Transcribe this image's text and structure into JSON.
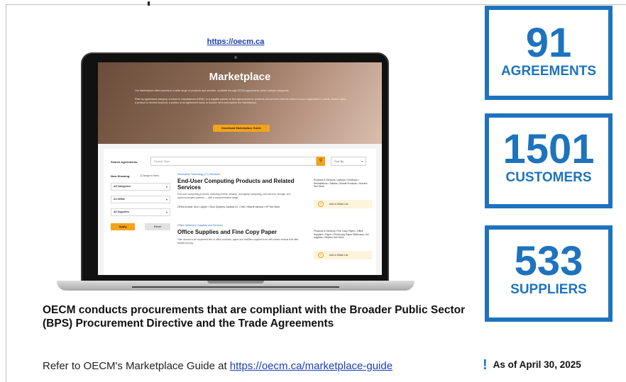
{
  "top_url": "https://oecm.ca",
  "marketplace": {
    "title": "Marketplace",
    "intro": "Our Marketplace offers access to a wide range of products and services, available through OECM agreements within multiple categories.",
    "intro2": "Filter by agreement category, a brand or manufacturer (OEM), or a supplier partner to find agreements for products and services that are based on your organization's needs. Search using a product or service keyword, a portion of an agreement name or another term and explore the Marketplace.",
    "download_label": "Download Marketplace Guide",
    "search_label": "Search Agreements",
    "search_placeholder": "Search Term",
    "search_icon": "magnifier-icon",
    "sort_label": "Sort By",
    "now_showing": "Now Showing:",
    "change_filter": "(Change to filter)",
    "filters": [
      "All Categories",
      "All OEMs",
      "All Suppliers"
    ],
    "apply_label": "Apply",
    "reset_label": "Reset",
    "results": [
      {
        "category": "Information Technology (IT) Hardware",
        "title": "End-User Computing Products and Related Services",
        "desc": "End-user computing products, including mobile, desktop, and laptop computing, plus servers, storage, and hyperconverged systems — with a comprehensive range...",
        "oems": "OEMs Include: Acer • Apple • Cisco Systems Canada Co. • Dell • Hitachi Vantara • HP See More",
        "side": "Products & Services: Laptops • Desktops • Workstations • Tablets • Mobile Products • Servers See More",
        "watch": "Add to Watch List"
      },
      {
        "category": "Office Stationery, Supplies and Services",
        "title": "Office Supplies and Fine Copy Paper",
        "desc": "Gain access to an expanded line of office products, paper and facilities supplies from well-known brands that offer flexible pricing...",
        "oems": "",
        "side": "Products & Services: Fine Copy Paper • Office Supplies • Paper • Photocopy Paper Stationery • Art supplies • Binders See More",
        "watch": "Add to Watch List"
      }
    ]
  },
  "headline": "OECM conducts procurements that are compliant with the Broader Public Sector (BPS) Procurement Directive and the Trade Agreements",
  "refer_text": "Refer to OECM's Marketplace Guide at ",
  "refer_link": "https://oecm.ca/marketplace-guide",
  "stats": [
    {
      "value": "91",
      "label": "AGREEMENTS"
    },
    {
      "value": "1501",
      "label": "CUSTOMERS"
    },
    {
      "value": "533",
      "label": "SUPPLIERS"
    }
  ],
  "as_of": "As of  April 30, 2025",
  "accent_color": "#1e73be",
  "button_color": "#f5a31a"
}
